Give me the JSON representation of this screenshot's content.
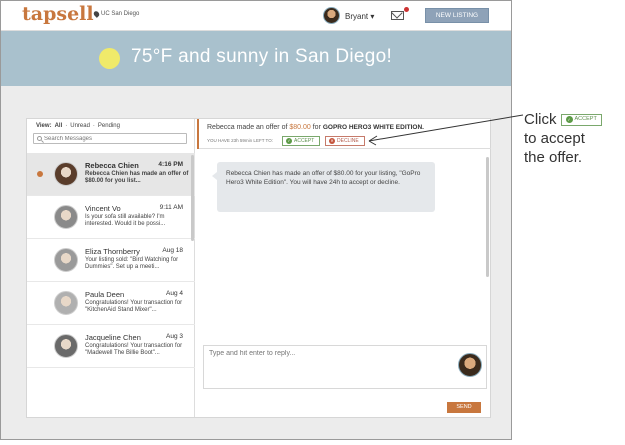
{
  "app": {
    "logo": "tapsell",
    "location": "UC San Diego",
    "username": "Bryant ▾",
    "new_listing_label": "NEW LISTING"
  },
  "weather": {
    "text": "75°F and sunny in San Diego!"
  },
  "inbox": {
    "filters": {
      "lead": "View:",
      "all": "All",
      "sep1": "·",
      "unread": "Unread",
      "sep2": "·",
      "pending": "Pending"
    },
    "search_placeholder": "Search Messages",
    "conversations": [
      {
        "name": "Rebecca Chien",
        "time": "4:16 PM",
        "snippet": "Rebecca Chien has made an offer of $80.00 for you list...",
        "unread": true,
        "avatar_color": "#5a3d2b"
      },
      {
        "name": "Vincent Vo",
        "time": "9:11 AM",
        "snippet": "Is your sofa still available? I'm interested. Would it be possi...",
        "unread": false,
        "avatar_color": "#8a8a8a"
      },
      {
        "name": "Eliza Thornberry",
        "time": "Aug 18",
        "snippet": "Your listing sold: \"Bird Watching for Dummies\". Set up a meeti...",
        "unread": false,
        "avatar_color": "#9a9a9a"
      },
      {
        "name": "Paula Deen",
        "time": "Aug 4",
        "snippet": "Congratulations! Your transaction for \"KitchenAid Stand Mixer\"...",
        "unread": false,
        "avatar_color": "#b0b0b0"
      },
      {
        "name": "Jacqueline Chen",
        "time": "Aug 3",
        "snippet": "Congratulations! Your transaction for \"Madewell The Billie Boot\"...",
        "unread": false,
        "avatar_color": "#6a6a6a"
      }
    ]
  },
  "offer": {
    "prefix": "Rebecca made an offer of ",
    "amount": "$80.00",
    "middle": " for ",
    "item": "GOPRO HERO3 WHITE EDITION.",
    "time_left": "YOU HAVE 23h 59min LEFT TO:",
    "accept_label": "ACCEPT",
    "decline_label": "DECLINE"
  },
  "message": {
    "body": "Rebecca Chien has made an offer of $80.00 for your listing, \"GoPro Hero3 White Edition\". You will have 24h to accept or decline."
  },
  "reply": {
    "placeholder": "Type and hit enter to reply...",
    "send_label": "SEND"
  },
  "annotation": {
    "line1": "Click",
    "accept_label": "ACCEPT",
    "line2": "to accept",
    "line3": "the offer."
  },
  "colors": {
    "brand": "#c8773e",
    "accept": "#5c9a46",
    "decline": "#c4543c",
    "weather_banner": "#a9c1cd"
  },
  "icons": [
    "location-pin-icon",
    "mail-icon",
    "search-icon",
    "check-icon",
    "x-icon",
    "sun-icon"
  ]
}
